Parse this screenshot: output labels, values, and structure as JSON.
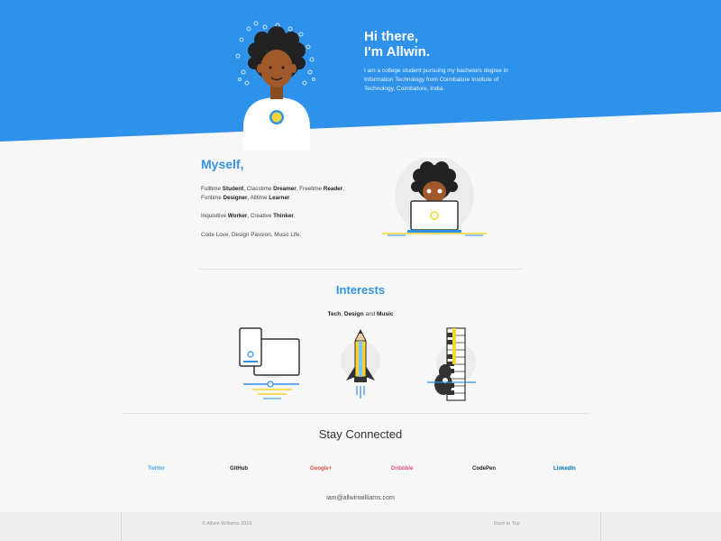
{
  "hero": {
    "title_line1": "Hi there,",
    "title_line2": "I'm Allwin.",
    "description": "I am a college student pursuing my bachelors degree in Information Technology from Coimbatore Institute of Technology, Coimbatore, India."
  },
  "myself": {
    "title": "Myself,",
    "line1": [
      {
        "t": "Fulltime ",
        "b": false
      },
      {
        "t": "Student",
        "b": true
      },
      {
        "t": ", Classtime ",
        "b": false
      },
      {
        "t": "Dreamer",
        "b": true
      },
      {
        "t": ", Freetime ",
        "b": false
      },
      {
        "t": "Reader",
        "b": true
      },
      {
        "t": ", Funtime ",
        "b": false
      },
      {
        "t": "Designer",
        "b": true
      },
      {
        "t": ", Alltime ",
        "b": false
      },
      {
        "t": "Learner",
        "b": true
      },
      {
        "t": ".",
        "b": false
      }
    ],
    "line2": [
      {
        "t": "Inquisitive ",
        "b": false
      },
      {
        "t": "Worker",
        "b": true
      },
      {
        "t": ", Creative ",
        "b": false
      },
      {
        "t": "Thinker",
        "b": true
      },
      {
        "t": ".",
        "b": false
      }
    ],
    "line3": "Code Love, Design Passion, Music Life."
  },
  "interests": {
    "title": "Interests",
    "sub": {
      "a": "Tech",
      "b": ", ",
      "c": "Design",
      "d": " and ",
      "e": "Music"
    }
  },
  "connect": {
    "title": "Stay Connected",
    "links": [
      {
        "label": "Twitter",
        "color": "#55acee"
      },
      {
        "label": "GitHub",
        "color": "#222222"
      },
      {
        "label": "Google+",
        "color": "#dd4b39"
      },
      {
        "label": "Dribbble",
        "color": "#ea4c89"
      },
      {
        "label": "CodePen",
        "color": "#222222"
      },
      {
        "label": "LinkedIn",
        "color": "#0077b5"
      }
    ],
    "email": "iam@allwinwilliams.com"
  },
  "footer": {
    "copyright": "© Allwin Williams 2016",
    "back_to_top": "Back to Top"
  },
  "colors": {
    "brand_blue": "#2f92ea",
    "accent_yellow": "#f5d533",
    "skin": "#a0592b"
  }
}
